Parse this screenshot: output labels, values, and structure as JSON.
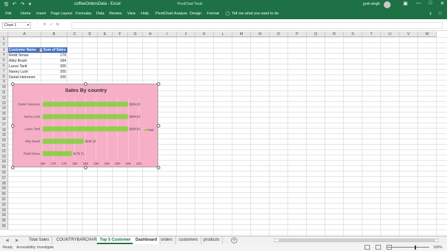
{
  "titlebar": {
    "doc_title": "coffeeOrdersData - Excel",
    "context": "PivotChart Tools",
    "user": "jyoti singh",
    "undo_icon": "undo-icon",
    "redo_icon": "redo-icon",
    "save_icon": "save-icon"
  },
  "ribbon": {
    "tabs": [
      "File",
      "Home",
      "Insert",
      "Page Layout",
      "Formulas",
      "Data",
      "Review",
      "View",
      "Help",
      "PivotChart Analyze",
      "Design",
      "Format"
    ],
    "tell_me": "Tell me what you want to do"
  },
  "formula_bar": {
    "name_box": "Chart 1",
    "fx": "fx",
    "value": ""
  },
  "columns": [
    "A",
    "B",
    "C",
    "D",
    "E",
    "F",
    "G",
    "H",
    "I",
    "J",
    "K",
    "L",
    "M",
    "N",
    "O",
    "P",
    "Q",
    "R",
    "S",
    "T",
    "U",
    "V",
    "W"
  ],
  "rows": [
    "1",
    "2",
    "3",
    "4",
    "5",
    "6",
    "7",
    "8",
    "9",
    "10",
    "11",
    "12",
    "13",
    "14",
    "15",
    "16",
    "17",
    "18",
    "19",
    "20",
    "21",
    "22",
    "23",
    "24",
    "25",
    "26",
    "27",
    "28",
    "29",
    "30",
    "31",
    "32",
    "33",
    "34",
    "35",
    "36"
  ],
  "pivot": {
    "header_name": "Customer Name",
    "header_value": "Sum of Sales",
    "rows": [
      {
        "name": "Redd Simao",
        "value": "179"
      },
      {
        "name": "Alley Brash",
        "value": "184"
      },
      {
        "name": "Lacee Tanti",
        "value": "205"
      },
      {
        "name": "Nanny Lush",
        "value": "205"
      },
      {
        "name": "Daniel Heinonen",
        "value": "205"
      }
    ]
  },
  "chart_data": {
    "type": "bar",
    "orientation": "horizontal",
    "title": "Sales By country",
    "categories": [
      "Daniel Heinonen",
      "Nanny Lush",
      "Lacee Tanti",
      "Alley Brash",
      "Redd Simao"
    ],
    "series": [
      {
        "name": "Total",
        "values": [
          204.93,
          204.93,
          204.93,
          184.23,
          178.71
        ]
      }
    ],
    "value_labels": [
      "$204.93",
      "$204.93",
      "$204.93",
      "$184.23",
      "$178.71"
    ],
    "xlim": [
      165,
      210
    ],
    "x_ticks": [
      "165",
      "170",
      "175",
      "180",
      "185",
      "190",
      "195",
      "200",
      "205",
      "210"
    ],
    "grid": true,
    "legend": "right",
    "bar_color": "#8fcf4a",
    "background": "#f7aec7"
  },
  "sheets": [
    {
      "label": "Total Sales",
      "state": ""
    },
    {
      "label": "COUNTRYBARCHART",
      "state": ""
    },
    {
      "label": "Top 5 Customer",
      "state": "active"
    },
    {
      "label": "Dashboard",
      "state": "sel"
    },
    {
      "label": "orders",
      "state": ""
    },
    {
      "label": "customers",
      "state": ""
    },
    {
      "label": "products",
      "state": ""
    }
  ],
  "status": {
    "ready": "Ready",
    "accessibility": "Accessibility: Investigate",
    "zoom": "100%"
  }
}
